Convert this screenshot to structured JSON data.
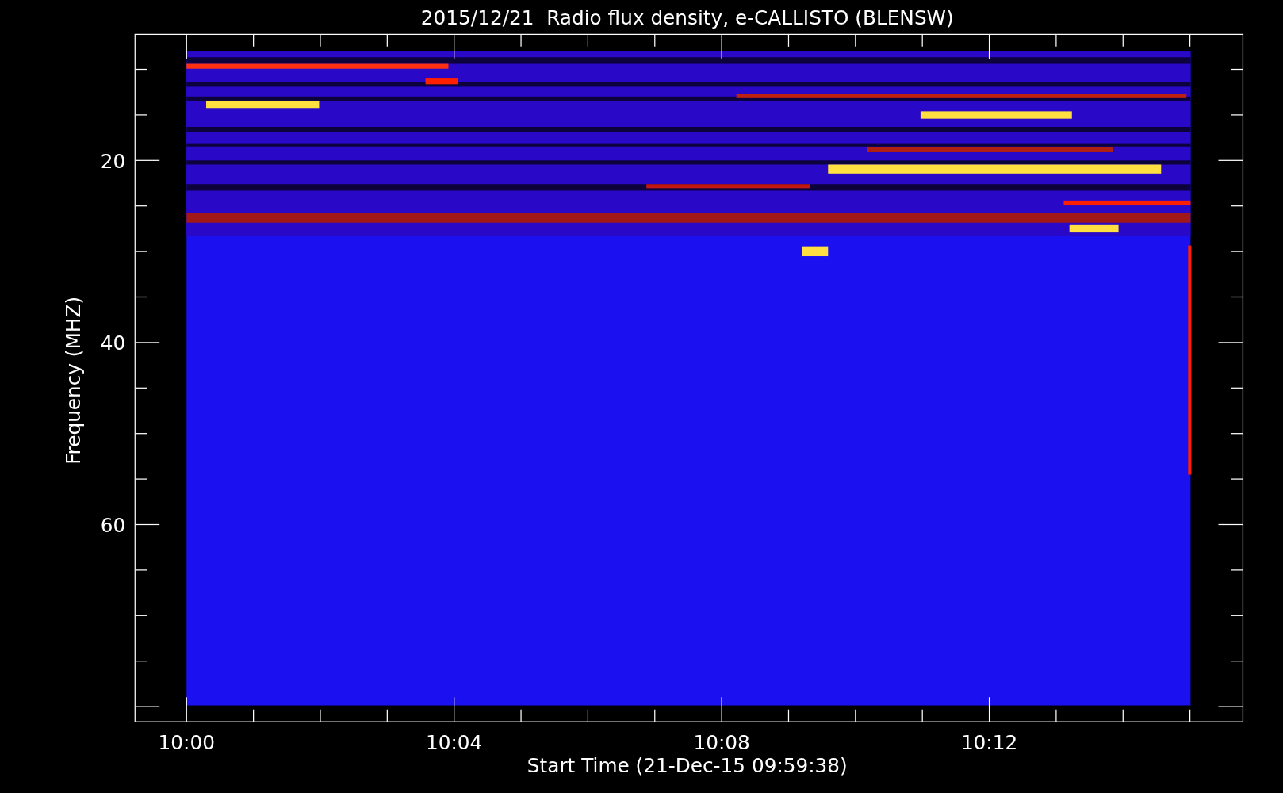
{
  "title": "2015/12/21  Radio flux density, e-CALLISTO (BLENSW)",
  "ylabel": "Frequency (MHZ)",
  "xlabel": "Start Time (21-Dec-15 09:59:38)",
  "yticks": [
    {
      "label": "20"
    },
    {
      "label": "40"
    },
    {
      "label": "60"
    }
  ],
  "xticks": [
    {
      "label": "10:00"
    },
    {
      "label": "10:04"
    },
    {
      "label": "10:08"
    },
    {
      "label": "10:12"
    }
  ]
}
